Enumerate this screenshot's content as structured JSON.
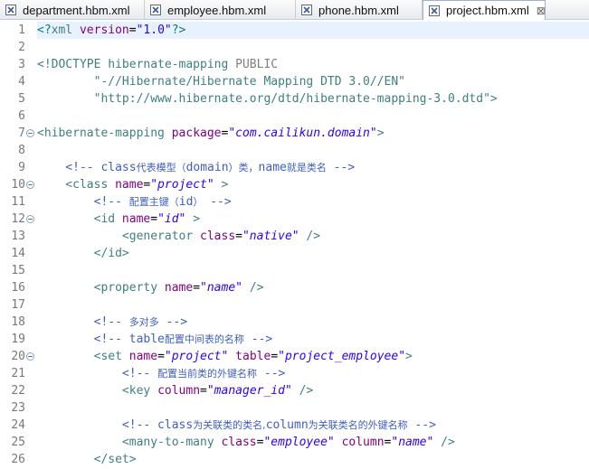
{
  "tabs": [
    {
      "label": "department.hbm.xml",
      "active": false
    },
    {
      "label": "employee.hbm.xml",
      "active": false
    },
    {
      "label": "phone.hbm.xml",
      "active": false
    },
    {
      "label": "project.hbm.xml",
      "active": true,
      "close": "⊠"
    }
  ],
  "colors": {
    "tag": "#3f7f7f",
    "attr": "#7f007f",
    "value": "#2a00ff",
    "comment": "#3f5fbf",
    "decl": "#008080",
    "plain": "#000000",
    "doctype_kw": "#808080"
  },
  "lines": [
    {
      "n": "1",
      "segs": [
        [
          "decl",
          "<?"
        ],
        [
          "tag",
          "xml "
        ],
        [
          "attr",
          "version"
        ],
        [
          "plain",
          "="
        ],
        [
          "value",
          "\"1.0\""
        ],
        [
          "decl",
          "?>"
        ]
      ],
      "current": true
    },
    {
      "n": "2",
      "segs": []
    },
    {
      "n": "3",
      "segs": [
        [
          "tag",
          "<!DOCTYPE hibernate-mapping "
        ],
        [
          "doctype_kw",
          "PUBLIC"
        ]
      ]
    },
    {
      "n": "4",
      "segs": [
        [
          "tag",
          "        \"-//Hibernate/Hibernate Mapping DTD 3.0//EN\""
        ]
      ]
    },
    {
      "n": "5",
      "segs": [
        [
          "tag",
          "        \"http://www.hibernate.org/dtd/hibernate-mapping-3.0.dtd\">"
        ]
      ]
    },
    {
      "n": "6",
      "segs": []
    },
    {
      "n": "7",
      "fold": true,
      "segs": [
        [
          "tag",
          "<hibernate-mapping "
        ],
        [
          "attr",
          "package"
        ],
        [
          "plain",
          "="
        ],
        [
          "value_i",
          "\"com.cailikun.domain\""
        ],
        [
          "tag",
          ">"
        ]
      ]
    },
    {
      "n": "8",
      "segs": []
    },
    {
      "n": "9",
      "segs": [
        [
          "comment",
          "    <!-- class"
        ],
        [
          "comment_cjk",
          "代表模型（"
        ],
        [
          "comment",
          "domain"
        ],
        [
          "comment_cjk",
          "）类，"
        ],
        [
          "comment",
          "name"
        ],
        [
          "comment_cjk",
          "就是类名"
        ],
        [
          "comment",
          " -->"
        ]
      ]
    },
    {
      "n": "10",
      "fold": true,
      "segs": [
        [
          "tag",
          "    <class "
        ],
        [
          "attr",
          "name"
        ],
        [
          "plain",
          "="
        ],
        [
          "value_i",
          "\"project\""
        ],
        [
          "tag",
          " >"
        ]
      ]
    },
    {
      "n": "11",
      "segs": [
        [
          "comment",
          "        <!-- "
        ],
        [
          "comment_cjk",
          "配置主键（"
        ],
        [
          "comment",
          "id"
        ],
        [
          "comment_cjk",
          "）"
        ],
        [
          "comment",
          " -->"
        ]
      ]
    },
    {
      "n": "12",
      "fold": true,
      "segs": [
        [
          "tag",
          "        <id "
        ],
        [
          "attr",
          "name"
        ],
        [
          "plain",
          "="
        ],
        [
          "value_i",
          "\"id\""
        ],
        [
          "tag",
          " >"
        ]
      ]
    },
    {
      "n": "13",
      "segs": [
        [
          "tag",
          "            <generator "
        ],
        [
          "attr",
          "class"
        ],
        [
          "plain",
          "="
        ],
        [
          "value_i",
          "\"native\""
        ],
        [
          "tag",
          " />"
        ]
      ]
    },
    {
      "n": "14",
      "segs": [
        [
          "tag",
          "        </id>"
        ]
      ]
    },
    {
      "n": "15",
      "segs": []
    },
    {
      "n": "16",
      "segs": [
        [
          "tag",
          "        <property "
        ],
        [
          "attr",
          "name"
        ],
        [
          "plain",
          "="
        ],
        [
          "value_i",
          "\"name\""
        ],
        [
          "tag",
          " />"
        ]
      ]
    },
    {
      "n": "17",
      "segs": []
    },
    {
      "n": "18",
      "segs": [
        [
          "comment",
          "        <!-- "
        ],
        [
          "comment_cjk",
          "多对多"
        ],
        [
          "comment",
          " -->"
        ]
      ]
    },
    {
      "n": "19",
      "segs": [
        [
          "comment",
          "        <!-- table"
        ],
        [
          "comment_cjk",
          "配置中间表的名称"
        ],
        [
          "comment",
          " -->"
        ]
      ]
    },
    {
      "n": "20",
      "fold": true,
      "segs": [
        [
          "tag",
          "        <set "
        ],
        [
          "attr",
          "name"
        ],
        [
          "plain",
          "="
        ],
        [
          "value_i",
          "\"project\""
        ],
        [
          "plain",
          " "
        ],
        [
          "attr",
          "table"
        ],
        [
          "plain",
          "="
        ],
        [
          "value_i",
          "\"project_employee\""
        ],
        [
          "tag",
          ">"
        ]
      ]
    },
    {
      "n": "21",
      "segs": [
        [
          "comment",
          "            <!-- "
        ],
        [
          "comment_cjk",
          "配置当前类的外键名称"
        ],
        [
          "comment",
          " -->"
        ]
      ]
    },
    {
      "n": "22",
      "segs": [
        [
          "tag",
          "            <key "
        ],
        [
          "attr",
          "column"
        ],
        [
          "plain",
          "="
        ],
        [
          "value_i",
          "\"manager_id\""
        ],
        [
          "tag",
          " />"
        ]
      ]
    },
    {
      "n": "23",
      "segs": []
    },
    {
      "n": "24",
      "segs": [
        [
          "comment",
          "            <!-- class"
        ],
        [
          "comment_cjk",
          "为关联类的类名,"
        ],
        [
          "comment",
          "column"
        ],
        [
          "comment_cjk",
          "为关联类名的外键名称"
        ],
        [
          "comment",
          " -->"
        ]
      ]
    },
    {
      "n": "25",
      "segs": [
        [
          "tag",
          "            <many-to-many "
        ],
        [
          "attr",
          "class"
        ],
        [
          "plain",
          "="
        ],
        [
          "value_i",
          "\"employee\""
        ],
        [
          "plain",
          " "
        ],
        [
          "attr",
          "column"
        ],
        [
          "plain",
          "="
        ],
        [
          "value_i",
          "\"name\""
        ],
        [
          "tag",
          " />"
        ]
      ]
    },
    {
      "n": "26",
      "segs": [
        [
          "tag",
          "        </set>"
        ]
      ]
    }
  ]
}
